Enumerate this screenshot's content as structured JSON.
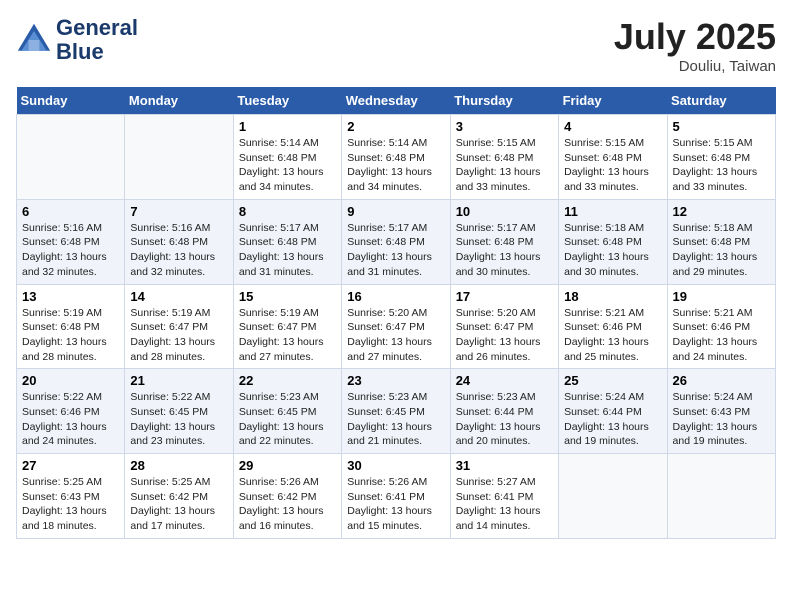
{
  "header": {
    "logo_line1": "General",
    "logo_line2": "Blue",
    "month": "July 2025",
    "location": "Douliu, Taiwan"
  },
  "weekdays": [
    "Sunday",
    "Monday",
    "Tuesday",
    "Wednesday",
    "Thursday",
    "Friday",
    "Saturday"
  ],
  "weeks": [
    [
      {
        "day": "",
        "sunrise": "",
        "sunset": "",
        "daylight": ""
      },
      {
        "day": "",
        "sunrise": "",
        "sunset": "",
        "daylight": ""
      },
      {
        "day": "1",
        "sunrise": "Sunrise: 5:14 AM",
        "sunset": "Sunset: 6:48 PM",
        "daylight": "Daylight: 13 hours and 34 minutes."
      },
      {
        "day": "2",
        "sunrise": "Sunrise: 5:14 AM",
        "sunset": "Sunset: 6:48 PM",
        "daylight": "Daylight: 13 hours and 34 minutes."
      },
      {
        "day": "3",
        "sunrise": "Sunrise: 5:15 AM",
        "sunset": "Sunset: 6:48 PM",
        "daylight": "Daylight: 13 hours and 33 minutes."
      },
      {
        "day": "4",
        "sunrise": "Sunrise: 5:15 AM",
        "sunset": "Sunset: 6:48 PM",
        "daylight": "Daylight: 13 hours and 33 minutes."
      },
      {
        "day": "5",
        "sunrise": "Sunrise: 5:15 AM",
        "sunset": "Sunset: 6:48 PM",
        "daylight": "Daylight: 13 hours and 33 minutes."
      }
    ],
    [
      {
        "day": "6",
        "sunrise": "Sunrise: 5:16 AM",
        "sunset": "Sunset: 6:48 PM",
        "daylight": "Daylight: 13 hours and 32 minutes."
      },
      {
        "day": "7",
        "sunrise": "Sunrise: 5:16 AM",
        "sunset": "Sunset: 6:48 PM",
        "daylight": "Daylight: 13 hours and 32 minutes."
      },
      {
        "day": "8",
        "sunrise": "Sunrise: 5:17 AM",
        "sunset": "Sunset: 6:48 PM",
        "daylight": "Daylight: 13 hours and 31 minutes."
      },
      {
        "day": "9",
        "sunrise": "Sunrise: 5:17 AM",
        "sunset": "Sunset: 6:48 PM",
        "daylight": "Daylight: 13 hours and 31 minutes."
      },
      {
        "day": "10",
        "sunrise": "Sunrise: 5:17 AM",
        "sunset": "Sunset: 6:48 PM",
        "daylight": "Daylight: 13 hours and 30 minutes."
      },
      {
        "day": "11",
        "sunrise": "Sunrise: 5:18 AM",
        "sunset": "Sunset: 6:48 PM",
        "daylight": "Daylight: 13 hours and 30 minutes."
      },
      {
        "day": "12",
        "sunrise": "Sunrise: 5:18 AM",
        "sunset": "Sunset: 6:48 PM",
        "daylight": "Daylight: 13 hours and 29 minutes."
      }
    ],
    [
      {
        "day": "13",
        "sunrise": "Sunrise: 5:19 AM",
        "sunset": "Sunset: 6:48 PM",
        "daylight": "Daylight: 13 hours and 28 minutes."
      },
      {
        "day": "14",
        "sunrise": "Sunrise: 5:19 AM",
        "sunset": "Sunset: 6:47 PM",
        "daylight": "Daylight: 13 hours and 28 minutes."
      },
      {
        "day": "15",
        "sunrise": "Sunrise: 5:19 AM",
        "sunset": "Sunset: 6:47 PM",
        "daylight": "Daylight: 13 hours and 27 minutes."
      },
      {
        "day": "16",
        "sunrise": "Sunrise: 5:20 AM",
        "sunset": "Sunset: 6:47 PM",
        "daylight": "Daylight: 13 hours and 27 minutes."
      },
      {
        "day": "17",
        "sunrise": "Sunrise: 5:20 AM",
        "sunset": "Sunset: 6:47 PM",
        "daylight": "Daylight: 13 hours and 26 minutes."
      },
      {
        "day": "18",
        "sunrise": "Sunrise: 5:21 AM",
        "sunset": "Sunset: 6:46 PM",
        "daylight": "Daylight: 13 hours and 25 minutes."
      },
      {
        "day": "19",
        "sunrise": "Sunrise: 5:21 AM",
        "sunset": "Sunset: 6:46 PM",
        "daylight": "Daylight: 13 hours and 24 minutes."
      }
    ],
    [
      {
        "day": "20",
        "sunrise": "Sunrise: 5:22 AM",
        "sunset": "Sunset: 6:46 PM",
        "daylight": "Daylight: 13 hours and 24 minutes."
      },
      {
        "day": "21",
        "sunrise": "Sunrise: 5:22 AM",
        "sunset": "Sunset: 6:45 PM",
        "daylight": "Daylight: 13 hours and 23 minutes."
      },
      {
        "day": "22",
        "sunrise": "Sunrise: 5:23 AM",
        "sunset": "Sunset: 6:45 PM",
        "daylight": "Daylight: 13 hours and 22 minutes."
      },
      {
        "day": "23",
        "sunrise": "Sunrise: 5:23 AM",
        "sunset": "Sunset: 6:45 PM",
        "daylight": "Daylight: 13 hours and 21 minutes."
      },
      {
        "day": "24",
        "sunrise": "Sunrise: 5:23 AM",
        "sunset": "Sunset: 6:44 PM",
        "daylight": "Daylight: 13 hours and 20 minutes."
      },
      {
        "day": "25",
        "sunrise": "Sunrise: 5:24 AM",
        "sunset": "Sunset: 6:44 PM",
        "daylight": "Daylight: 13 hours and 19 minutes."
      },
      {
        "day": "26",
        "sunrise": "Sunrise: 5:24 AM",
        "sunset": "Sunset: 6:43 PM",
        "daylight": "Daylight: 13 hours and 19 minutes."
      }
    ],
    [
      {
        "day": "27",
        "sunrise": "Sunrise: 5:25 AM",
        "sunset": "Sunset: 6:43 PM",
        "daylight": "Daylight: 13 hours and 18 minutes."
      },
      {
        "day": "28",
        "sunrise": "Sunrise: 5:25 AM",
        "sunset": "Sunset: 6:42 PM",
        "daylight": "Daylight: 13 hours and 17 minutes."
      },
      {
        "day": "29",
        "sunrise": "Sunrise: 5:26 AM",
        "sunset": "Sunset: 6:42 PM",
        "daylight": "Daylight: 13 hours and 16 minutes."
      },
      {
        "day": "30",
        "sunrise": "Sunrise: 5:26 AM",
        "sunset": "Sunset: 6:41 PM",
        "daylight": "Daylight: 13 hours and 15 minutes."
      },
      {
        "day": "31",
        "sunrise": "Sunrise: 5:27 AM",
        "sunset": "Sunset: 6:41 PM",
        "daylight": "Daylight: 13 hours and 14 minutes."
      },
      {
        "day": "",
        "sunrise": "",
        "sunset": "",
        "daylight": ""
      },
      {
        "day": "",
        "sunrise": "",
        "sunset": "",
        "daylight": ""
      }
    ]
  ]
}
